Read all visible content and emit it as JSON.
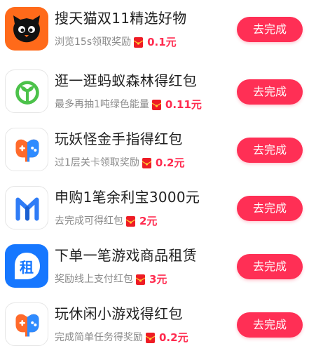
{
  "colors": {
    "accent": "#ff2f55",
    "reward_text": "#ff2b4f",
    "title_text": "#1f1f1f",
    "desc_text": "#8a8a8a"
  },
  "tasks": [
    {
      "icon": "tmall-cat-icon",
      "title": "搜天猫双11精选好物",
      "desc": "浏览15s领取奖励",
      "reward": "0.1元",
      "button": "去完成"
    },
    {
      "icon": "ant-forest-icon",
      "title": "逛一逛蚂蚁森林得红包",
      "desc": "最多再抽1吨绿色能量",
      "reward": "0.11元",
      "button": "去完成"
    },
    {
      "icon": "game-controller-icon",
      "title": "玩妖怪金手指得红包",
      "desc": "过1层关卡领取奖励",
      "reward": "0.2元",
      "button": "去完成"
    },
    {
      "icon": "yuebao-m-icon",
      "title": "申购1笔余利宝3000元",
      "desc": "去完成可得红包",
      "reward": "2元",
      "button": "去完成"
    },
    {
      "icon": "rent-bubble-icon",
      "title": "下单一笔游戏商品租赁",
      "desc": "奖励线上支付红包",
      "reward": "3元",
      "button": "去完成"
    },
    {
      "icon": "game-controller-icon",
      "title": "玩休闲小游戏得红包",
      "desc": "完成简单任务得奖励",
      "reward": "0.2元",
      "button": "去完成"
    }
  ],
  "icon_glyphs": {
    "rent_char": "租"
  }
}
